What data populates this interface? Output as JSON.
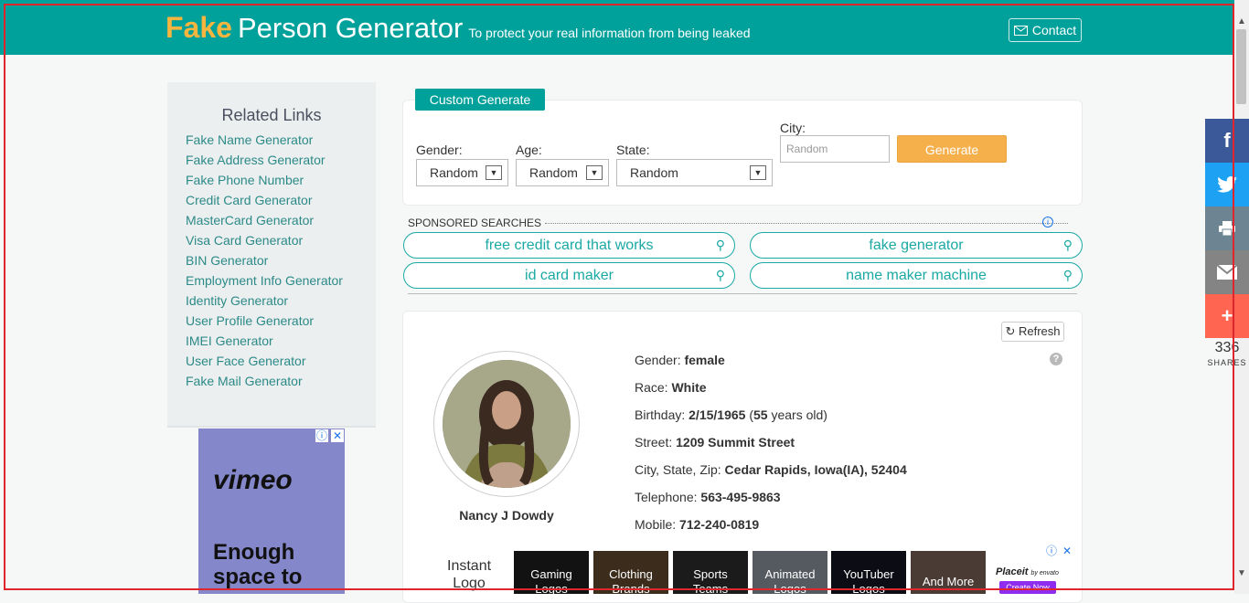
{
  "header": {
    "logo_fake": "Fake",
    "logo_name": "Person Generator",
    "tagline": "To protect your real information from being leaked",
    "contact_label": "Contact",
    "accent_color": "#00a09b"
  },
  "sidebar": {
    "title": "Related Links",
    "links": [
      "Fake Name Generator",
      "Fake Address Generator",
      "Fake Phone Number",
      "Credit Card Generator",
      "MasterCard Generator",
      "Visa Card Generator",
      "BIN Generator",
      "Employment Info Generator",
      "Identity Generator",
      "User Profile Generator",
      "IMEI Generator",
      "User Face Generator",
      "Fake Mail Generator"
    ]
  },
  "ad_left": {
    "brand": "vimeo",
    "headline_line1": "Enough",
    "headline_line2": "space to"
  },
  "custom_generate": {
    "tab_label": "Custom Generate",
    "gender_label": "Gender:",
    "gender_value": "Random",
    "age_label": "Age:",
    "age_value": "Random",
    "state_label": "State:",
    "state_value": "Random",
    "city_label": "City:",
    "city_placeholder": "Random",
    "generate_label": "Generate"
  },
  "sponsored": {
    "heading": "SPONSORED SEARCHES",
    "searches": [
      "free credit card that works",
      "fake generator",
      "id card maker",
      "name maker machine"
    ]
  },
  "person": {
    "refresh_label": "Refresh",
    "full_name": "Nancy J Dowdy",
    "gender_label": "Gender: ",
    "gender": "female",
    "race_label": "Race: ",
    "race": "White",
    "birthday_label": "Birthday: ",
    "birthday": "2/15/1965",
    "age_open": " (",
    "age": "55",
    "age_suffix": " years old)",
    "street_label": "Street: ",
    "street": "1209 Summit Street",
    "city_label": "City, State, Zip: ",
    "city_state_zip": "Cedar Rapids, Iowa(IA), 52404",
    "telephone_label": "Telephone: ",
    "telephone": "563-495-9863",
    "mobile_label": "Mobile: ",
    "mobile": "712-240-0819"
  },
  "ad_bottom": {
    "intro_line1": "Instant",
    "intro_line2": "Logo",
    "tiles": [
      {
        "line1": "Gaming",
        "line2": "Logos"
      },
      {
        "line1": "Clothing",
        "line2": "Brands"
      },
      {
        "line1": "Sports",
        "line2": "Teams"
      },
      {
        "line1": "Animated",
        "line2": "Logos"
      },
      {
        "line1": "YouTuber",
        "line2": "Logos"
      },
      {
        "line1": "And More",
        "line2": ""
      }
    ],
    "brand": "Placeit",
    "brand_sub": "by envato",
    "cta": "Create Now"
  },
  "share": {
    "count": "336",
    "label": "SHARES",
    "buttons": [
      {
        "icon": "facebook-icon",
        "color": "#3b5998"
      },
      {
        "icon": "twitter-icon",
        "color": "#1da1f2"
      },
      {
        "icon": "print-icon",
        "color": "#6d8592"
      },
      {
        "icon": "email-icon",
        "color": "#848484"
      },
      {
        "icon": "plus-icon",
        "color": "#ff6550"
      }
    ]
  }
}
